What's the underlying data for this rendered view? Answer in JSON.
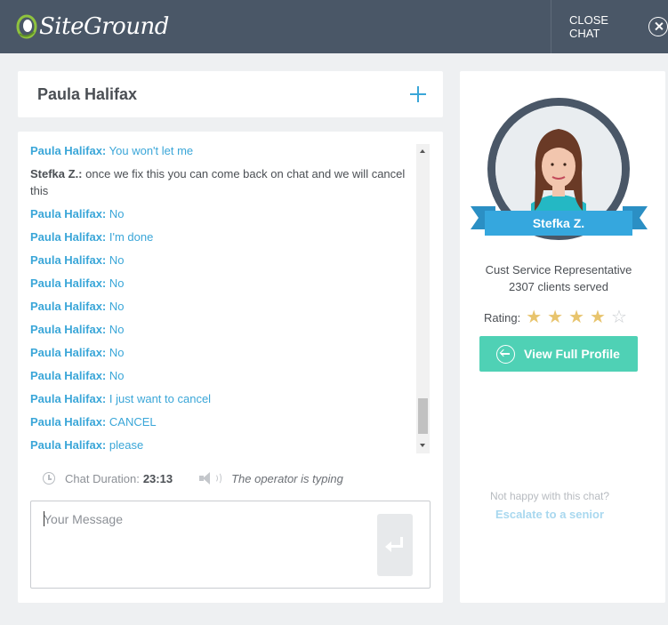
{
  "header": {
    "logo_text": "SiteGround",
    "close_label": "CLOSE CHAT"
  },
  "conversation": {
    "title": "Paula Halifax"
  },
  "messages": [
    {
      "who": "Paula Halifax:",
      "text": "You won't let me",
      "role": "client"
    },
    {
      "who": "Stefka Z.:",
      "text": "once we fix this you can come back on chat and we will cancel this",
      "role": "agent"
    },
    {
      "who": "Paula Halifax:",
      "text": "No",
      "role": "client"
    },
    {
      "who": "Paula Halifax:",
      "text": "I'm done",
      "role": "client"
    },
    {
      "who": "Paula Halifax:",
      "text": "No",
      "role": "client"
    },
    {
      "who": "Paula Halifax:",
      "text": "No",
      "role": "client"
    },
    {
      "who": "Paula Halifax:",
      "text": "No",
      "role": "client"
    },
    {
      "who": "Paula Halifax:",
      "text": "No",
      "role": "client"
    },
    {
      "who": "Paula Halifax:",
      "text": "No",
      "role": "client"
    },
    {
      "who": "Paula Halifax:",
      "text": "No",
      "role": "client"
    },
    {
      "who": "Paula Halifax:",
      "text": "I just want to cancel",
      "role": "client"
    },
    {
      "who": "Paula Halifax:",
      "text": "CANCEL",
      "role": "client"
    },
    {
      "who": "Paula Halifax:",
      "text": "please",
      "role": "client"
    }
  ],
  "status": {
    "duration_label": "Chat Duration:",
    "duration_value": "23:13",
    "typing_text": "The operator is typing"
  },
  "composer": {
    "placeholder": "Your Message",
    "value": ""
  },
  "agent": {
    "name": "Stefka Z.",
    "role": "Cust Service Representative",
    "served": "2307 clients served",
    "rating_label": "Rating:",
    "rating": 4,
    "rating_max": 5,
    "view_profile_label": "View Full Profile"
  },
  "escalation": {
    "prompt": "Not happy with this chat?",
    "link": "Escalate to a senior"
  },
  "colors": {
    "topbar": "#4a5767",
    "client_text": "#3aa6d8",
    "ribbon": "#35a7de",
    "profile_button": "#4fd1b5",
    "star": "#e8c46d"
  }
}
